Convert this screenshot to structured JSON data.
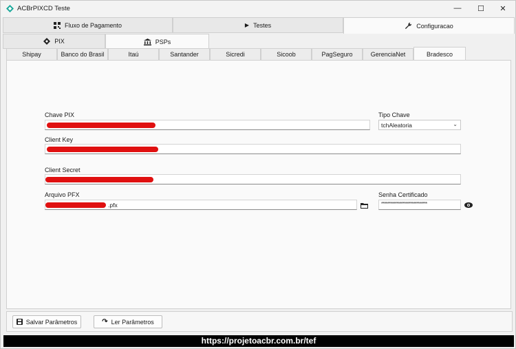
{
  "window": {
    "title": "ACBrPIXCD Teste",
    "minimize": "—",
    "maximize": "☐",
    "close": "✕"
  },
  "main_tabs": [
    {
      "label": "Fluxo de Pagamento",
      "icon": "qrcode-icon"
    },
    {
      "label": "Testes",
      "icon": "play-icon"
    },
    {
      "label": "Configuracao",
      "icon": "wrench-icon",
      "active": true
    }
  ],
  "sub_tabs": [
    {
      "label": "PIX",
      "icon": "pix-diamond-icon"
    },
    {
      "label": "PSPs",
      "icon": "bank-icon",
      "active": true
    }
  ],
  "psp_tabs": [
    {
      "label": "Shipay"
    },
    {
      "label": "Banco do Brasil"
    },
    {
      "label": "Itaú"
    },
    {
      "label": "Santander"
    },
    {
      "label": "Sicredi"
    },
    {
      "label": "Sicoob"
    },
    {
      "label": "PagSeguro"
    },
    {
      "label": "GerenciaNet"
    },
    {
      "label": "Bradesco",
      "active": true
    }
  ],
  "form": {
    "chave_pix_label": "Chave PIX",
    "tipo_chave_label": "Tipo Chave",
    "tipo_chave_value": "tchAleatoria",
    "client_key_label": "Client Key",
    "client_secret_label": "Client Secret",
    "arquivo_pfx_label": "Arquivo PFX",
    "arquivo_pfx_suffix": ".pfx",
    "senha_cert_label": "Senha Certificado",
    "senha_cert_value": "******************************"
  },
  "buttons": {
    "salvar": "Salvar Parâmetros",
    "ler": "Ler Parâmetros"
  },
  "footer": {
    "url": "https://projetoacbr.com.br/tef"
  },
  "colors": {
    "redaction": "#e01010",
    "accent_teal": "#1aa89a"
  }
}
